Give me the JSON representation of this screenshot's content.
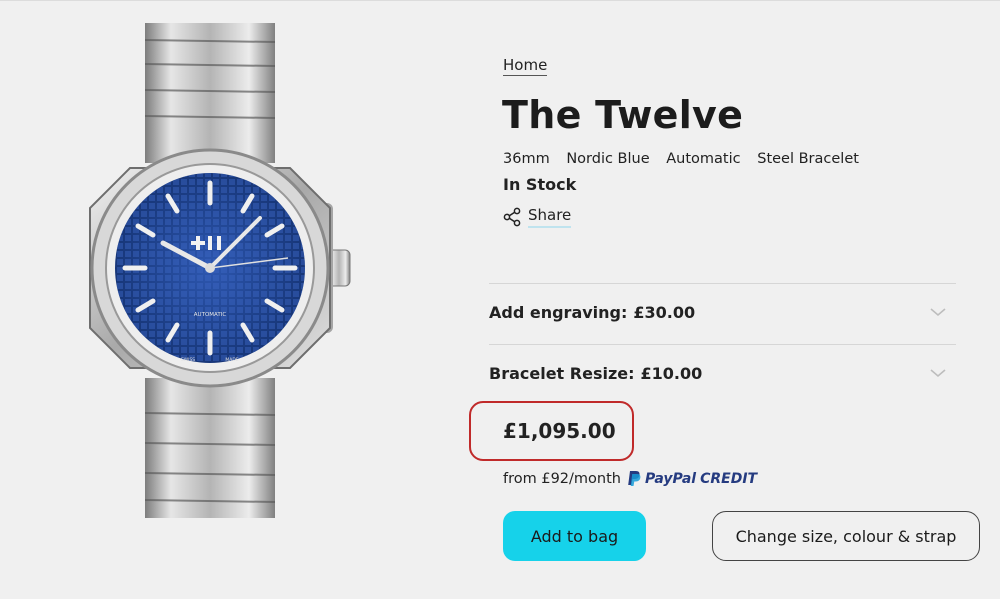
{
  "breadcrumb": {
    "home": "Home"
  },
  "product": {
    "title": "The Twelve",
    "attributes": [
      "36mm",
      "Nordic Blue",
      "Automatic",
      "Steel Bracelet"
    ],
    "stock": "In Stock",
    "image_alt": "The Twelve watch, blue dial, steel bracelet",
    "dial_texts": {
      "automatic": "AUTOMATIC",
      "swiss": "SWISS",
      "made": "MADE"
    }
  },
  "share": {
    "label": "Share",
    "icon": "share-icon"
  },
  "options": [
    {
      "label": "Add engraving:",
      "price": "£30.00",
      "icon": "chevron-down-icon"
    },
    {
      "label": "Bracelet Resize:",
      "price": "£10.00",
      "icon": "chevron-down-icon"
    }
  ],
  "price": "£1,095.00",
  "finance": {
    "text": "from £92/month",
    "paypal_word1": "PayPal",
    "paypal_word2": "CREDIT"
  },
  "buttons": {
    "add_to_bag": "Add to bag",
    "change": "Change size, colour & strap"
  },
  "colors": {
    "accent": "#16d2ea",
    "highlight": "#c02a2a",
    "dial": "#1e3f8f"
  }
}
